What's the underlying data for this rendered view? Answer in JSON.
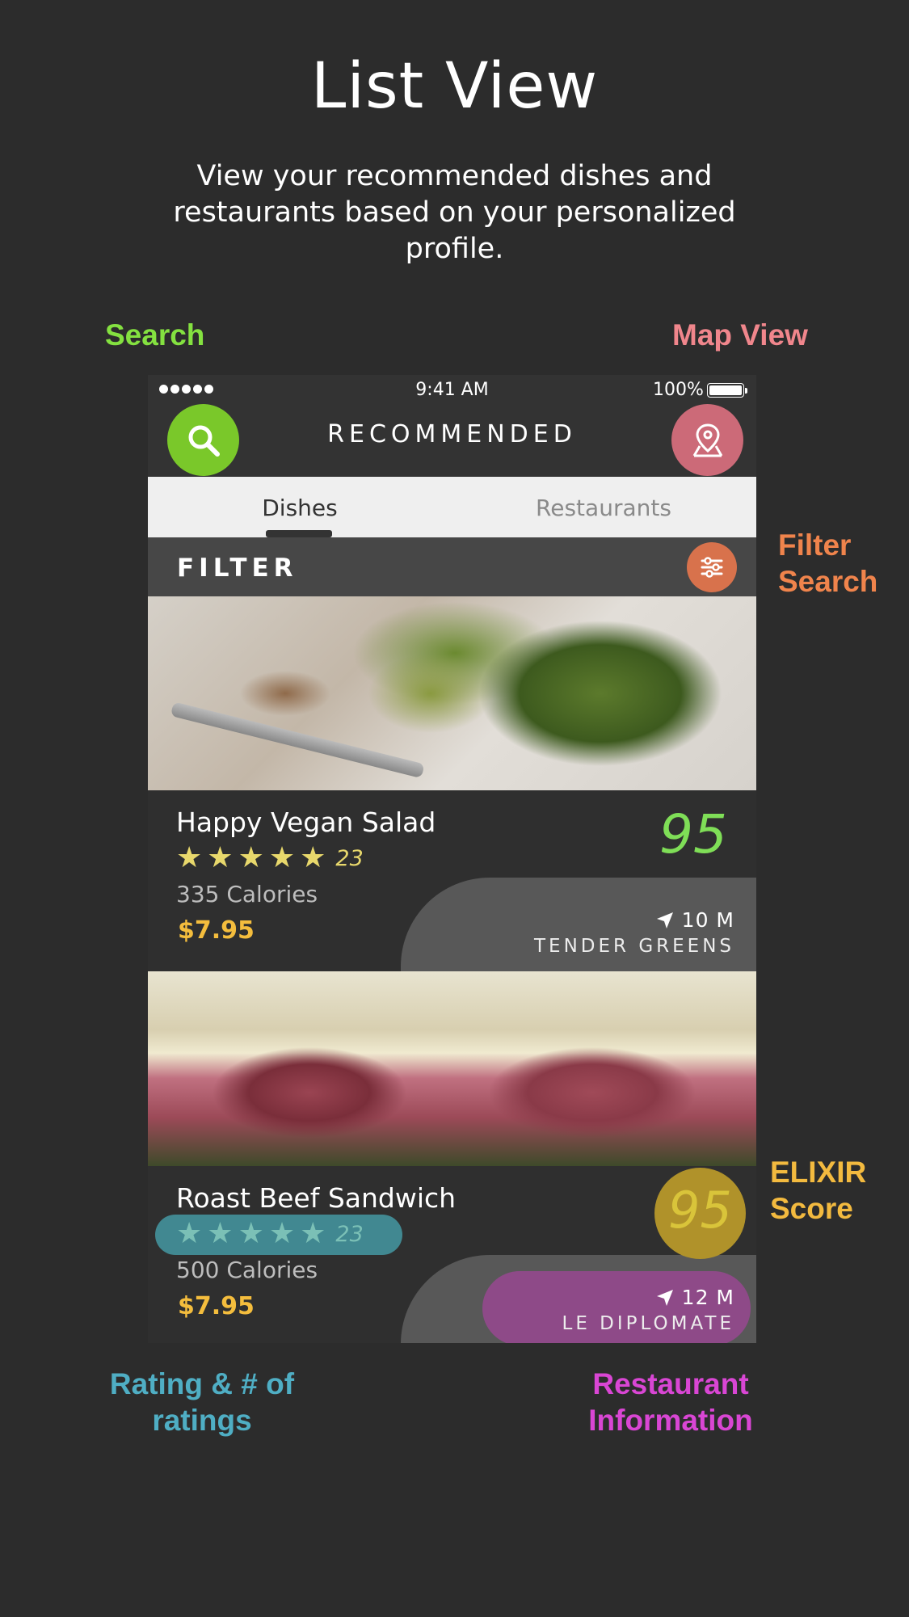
{
  "heading": {
    "title": "List View",
    "subtitle": "View your recommended dishes and restaurants based on your personalized profile."
  },
  "callouts": {
    "search": "Search",
    "map_view": "Map View",
    "filter_search": "Filter Search",
    "elixir_score": "ELIXIR Score",
    "rating": "Rating & # of ratings",
    "restaurant_info": "Restaurant Information"
  },
  "status_bar": {
    "time": "9:41 AM",
    "battery": "100%"
  },
  "header": {
    "title": "RECOMMENDED",
    "search_icon": "search-icon",
    "map_icon": "map-pin-icon"
  },
  "tabs": [
    {
      "label": "Dishes",
      "active": true
    },
    {
      "label": "Restaurants",
      "active": false
    }
  ],
  "filter": {
    "label": "FILTER",
    "icon": "sliders-icon"
  },
  "dishes": [
    {
      "name": "Happy Vegan Salad",
      "rating": 5,
      "rating_count": "23",
      "calories": "335 Calories",
      "price": "$7.95",
      "score": "95",
      "distance": "10 M",
      "restaurant": "TENDER GREENS"
    },
    {
      "name": "Roast Beef Sandwich",
      "rating": 5,
      "rating_count": "23",
      "calories": "500 Calories",
      "price": "$7.95",
      "score": "95",
      "distance": "12 M",
      "restaurant": "LE DIPLOMATE"
    }
  ],
  "colors": {
    "background": "#2c2c2c",
    "search_green": "#84e140",
    "map_pink": "#f0868c",
    "filter_orange": "#f0844c",
    "elixir_yellow": "#f3ba3f",
    "rating_teal": "#4faec4",
    "restaurant_magenta": "#d946d4",
    "price_yellow": "#f4bd3d",
    "score_green": "#7fde57"
  }
}
